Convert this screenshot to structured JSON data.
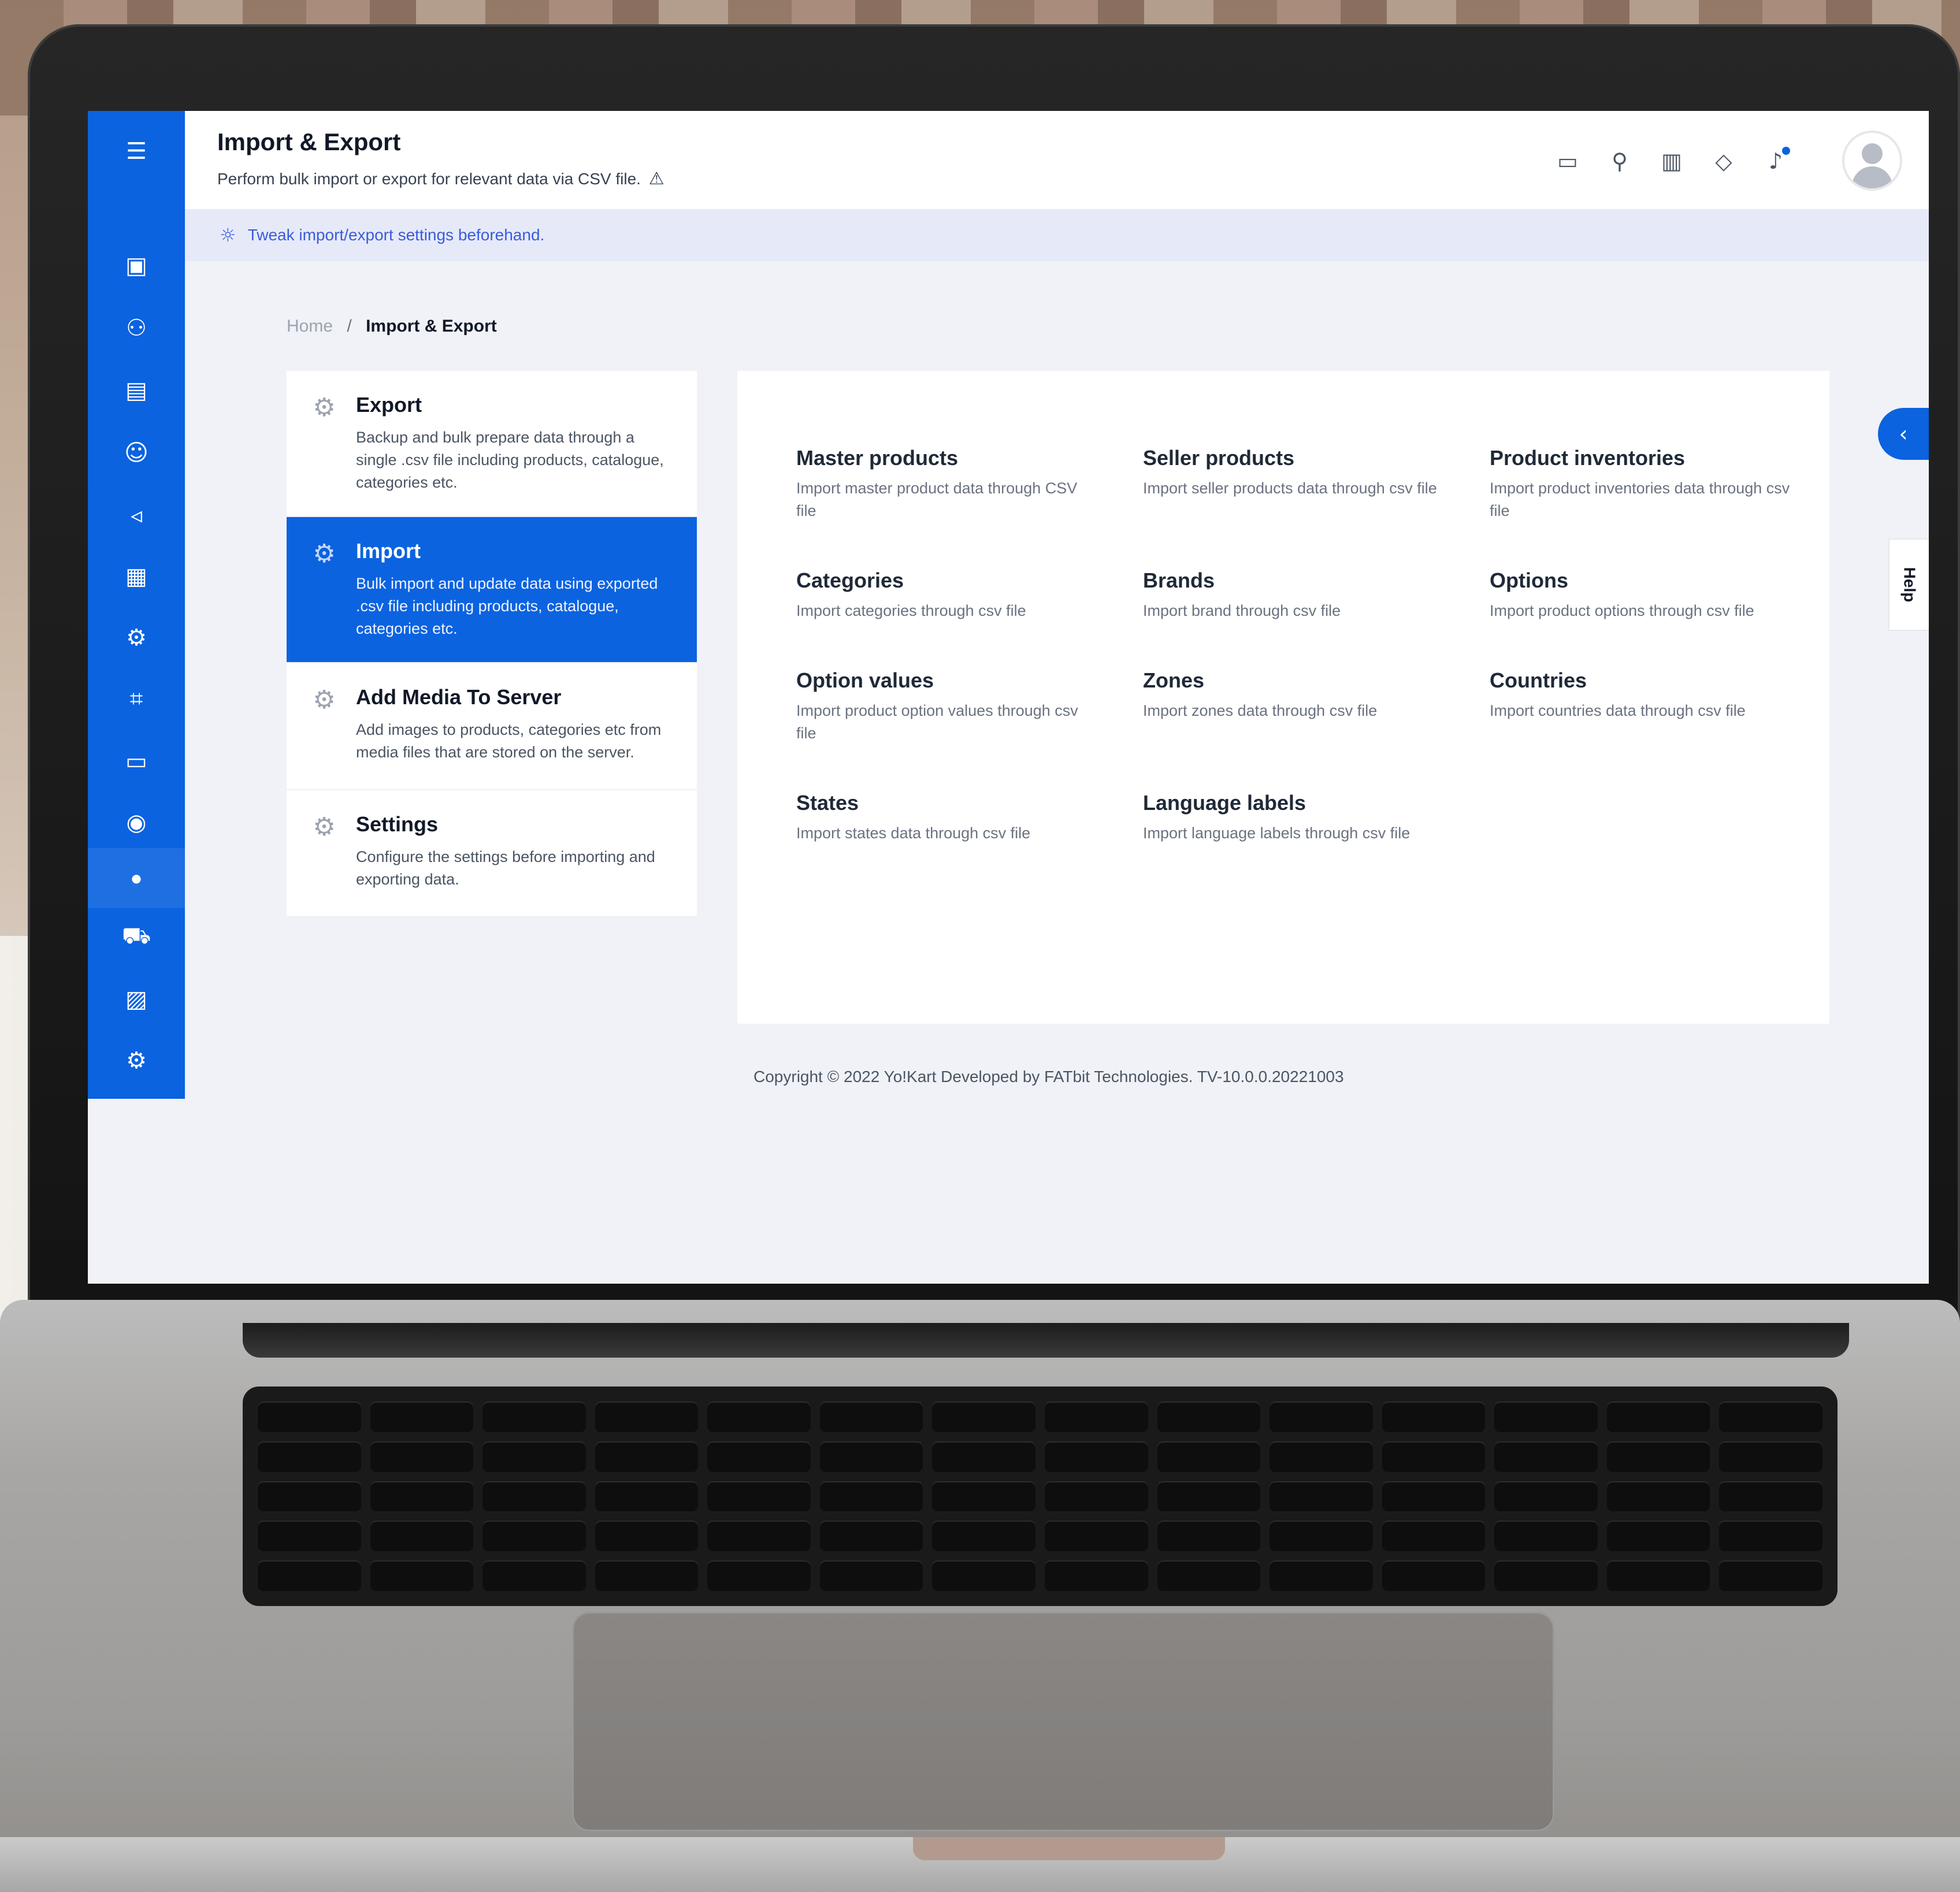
{
  "header": {
    "title": "Import & Export",
    "subtitle": "Perform bulk import or export for relevant data via CSV file.",
    "warning_icon": "⚠"
  },
  "tip": {
    "icon": "lightbulb-icon",
    "text": "Tweak import/export settings beforehand."
  },
  "breadcrumb": {
    "home": "Home",
    "separator": "/",
    "current": "Import & Export"
  },
  "menu": [
    {
      "title": "Export",
      "desc": "Backup and bulk prepare data through a single .csv file including products, catalogue, categories etc."
    },
    {
      "title": "Import",
      "desc": "Bulk import and update data using exported .csv file including products, catalogue, categories etc.",
      "active": true
    },
    {
      "title": "Add Media To Server",
      "desc": "Add images to products, categories etc from media files that are stored on the server."
    },
    {
      "title": "Settings",
      "desc": "Configure the settings before importing and exporting data."
    }
  ],
  "cards": [
    {
      "title": "Master products",
      "desc": "Import master product data through CSV file"
    },
    {
      "title": "Seller products",
      "desc": "Import seller products data through csv file"
    },
    {
      "title": "Product inventories",
      "desc": "Import product inventories data through csv file"
    },
    {
      "title": "Categories",
      "desc": "Import categories through csv file"
    },
    {
      "title": "Brands",
      "desc": "Import brand through csv file"
    },
    {
      "title": "Options",
      "desc": "Import product options through csv file"
    },
    {
      "title": "Option values",
      "desc": "Import product option values through csv file"
    },
    {
      "title": "Zones",
      "desc": "Import zones data through csv file"
    },
    {
      "title": "Countries",
      "desc": "Import countries data through csv file"
    },
    {
      "title": "States",
      "desc": "Import states data through csv file"
    },
    {
      "title": "Language labels",
      "desc": "Import language labels through csv file"
    }
  ],
  "footer": {
    "text": "Copyright © 2022 Yo!Kart Developed by FATbit Technologies. TV-10.0.0.20221003"
  },
  "help_tab": "Help",
  "colors": {
    "accent": "#0b63e0",
    "tip_bg": "#e6eaf8",
    "tip_text": "#3b5bdb"
  },
  "sidebar_icons": [
    "menu-icon",
    "orders-icon",
    "add-user-icon",
    "catalog-icon",
    "user-icon",
    "megaphone-icon",
    "reports-icon",
    "settings-gear-icon",
    "code-icon",
    "document-icon",
    "tax-icon",
    "dot-icon",
    "shipping-truck-icon",
    "analytics-icon",
    "system-settings-icon"
  ]
}
